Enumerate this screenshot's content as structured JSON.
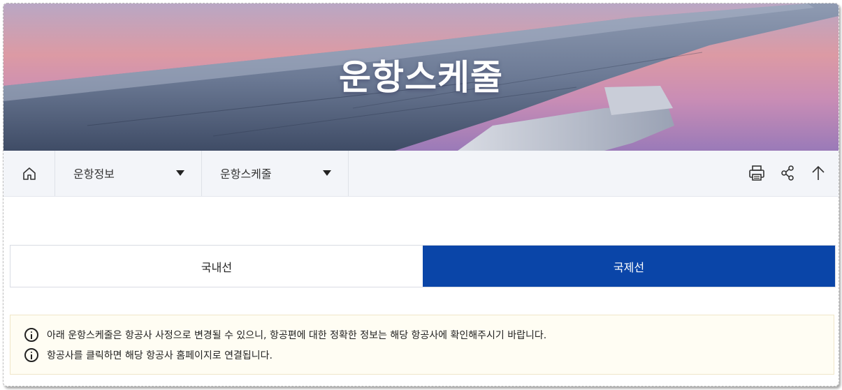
{
  "hero": {
    "title": "운항스케줄"
  },
  "navbar": {
    "home_icon": "home-icon",
    "dropdowns": [
      {
        "label": "운항정보"
      },
      {
        "label": "운항스케줄"
      }
    ],
    "tools": [
      "print-icon",
      "share-icon",
      "arrow-up-icon"
    ]
  },
  "tabs": [
    {
      "label": "국내선",
      "active": false
    },
    {
      "label": "국제선",
      "active": true
    }
  ],
  "notice": {
    "lines": [
      "아래 운항스케줄은 항공사 사정으로 변경될 수 있으니, 항공편에 대한 정확한 정보는 해당 항공사에 확인해주시기 바랍니다.",
      "항공사를 클릭하면 해당 항공사 홈페이지로 연결됩니다."
    ]
  },
  "colors": {
    "accent": "#0a45a8",
    "notice_bg": "#fffdf3",
    "navbar_bg": "#f3f5f9"
  }
}
